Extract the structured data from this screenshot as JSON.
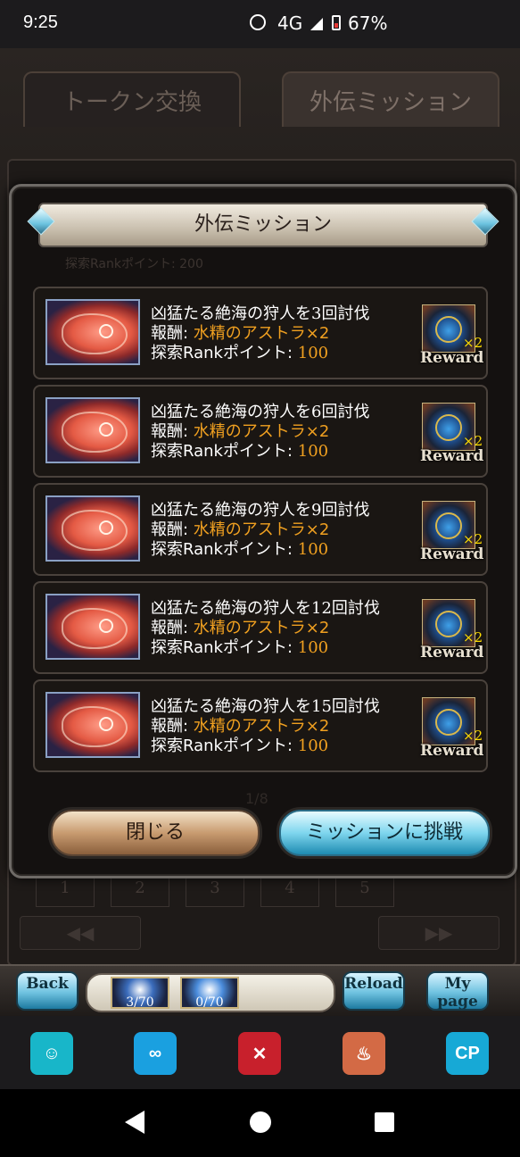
{
  "status_bar": {
    "time": "9:25",
    "network": "4G",
    "battery": "67%"
  },
  "tabs": [
    {
      "label": "トークン交換"
    },
    {
      "label": "外伝ミッション"
    }
  ],
  "background": {
    "page_numbers": [
      "1",
      "2",
      "3",
      "4",
      "5"
    ],
    "ghost_text": "探索Rankポイント: 200",
    "page_indicator": "1/8"
  },
  "modal": {
    "title": "外伝ミッション",
    "missions": [
      {
        "title_prefix": "凶猛たる絶海の狩人を",
        "count": "3",
        "title_suffix": "回討伐",
        "reward_label": "報酬: ",
        "reward_value": "水精のアストラ×2",
        "points_label": "探索Rankポイント: ",
        "points_value": "100",
        "reward_multiplier": "×2",
        "reward_caption": "Reward"
      },
      {
        "title_prefix": "凶猛たる絶海の狩人を",
        "count": "6",
        "title_suffix": "回討伐",
        "reward_label": "報酬: ",
        "reward_value": "水精のアストラ×2",
        "points_label": "探索Rankポイント: ",
        "points_value": "100",
        "reward_multiplier": "×2",
        "reward_caption": "Reward"
      },
      {
        "title_prefix": "凶猛たる絶海の狩人を",
        "count": "9",
        "title_suffix": "回討伐",
        "reward_label": "報酬: ",
        "reward_value": "水精のアストラ×2",
        "points_label": "探索Rankポイント: ",
        "points_value": "100",
        "reward_multiplier": "×2",
        "reward_caption": "Reward"
      },
      {
        "title_prefix": "凶猛たる絶海の狩人を",
        "count": "12",
        "title_suffix": "回討伐",
        "reward_label": "報酬: ",
        "reward_value": "水精のアストラ×2",
        "points_label": "探索Rankポイント: ",
        "points_value": "100",
        "reward_multiplier": "×2",
        "reward_caption": "Reward"
      },
      {
        "title_prefix": "凶猛たる絶海の狩人を",
        "count": "15",
        "title_suffix": "回討伐",
        "reward_label": "報酬: ",
        "reward_value": "水精のアストラ×2",
        "points_label": "探索Rankポイント: ",
        "points_value": "100",
        "reward_multiplier": "×2",
        "reward_caption": "Reward"
      }
    ],
    "close_label": "閉じる",
    "challenge_label": "ミッションに挑戦"
  },
  "footer": {
    "back_label": "Back",
    "reload_label": "Reload",
    "mypage_label": "My page",
    "ap_1": "3/70",
    "ap_2": "0/70"
  },
  "dock": {
    "cp_label": "CP"
  },
  "colors": {
    "reward_text": "#f0a020",
    "accent_button": "#7fd6ee",
    "close_button": "#c89b70"
  }
}
